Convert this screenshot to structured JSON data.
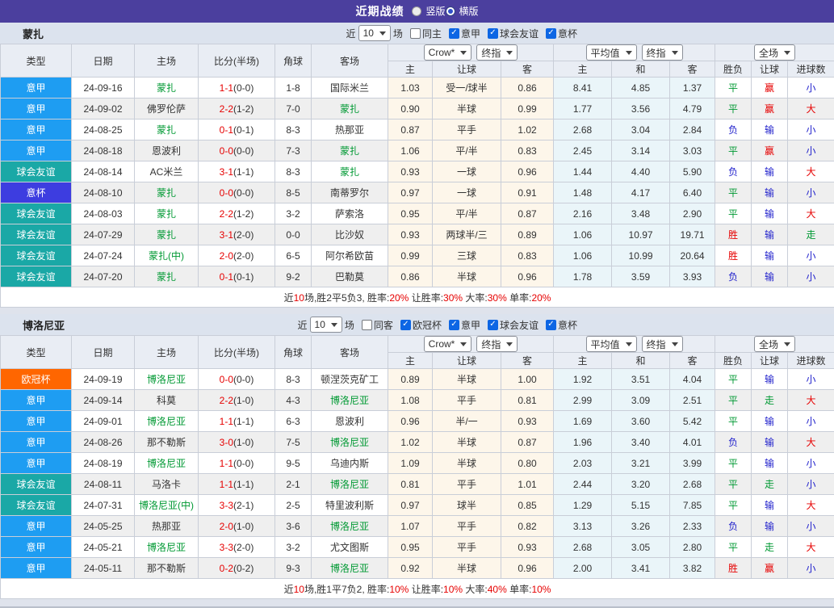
{
  "header": {
    "title": "近期战绩",
    "layout_options": [
      {
        "label": "竖版",
        "selected": false
      },
      {
        "label": "横版",
        "selected": true
      }
    ]
  },
  "filter_labels": {
    "near": "近",
    "suffix": "场"
  },
  "table_columns": {
    "main": [
      "类型",
      "日期",
      "主场",
      "比分(半场)",
      "角球",
      "客场"
    ],
    "odds_selects": [
      "Crow*",
      "终指"
    ],
    "avg_selects": [
      "平均值",
      "终指"
    ],
    "result_selects": [
      "全场"
    ],
    "odds_sub": [
      "主",
      "让球",
      "客"
    ],
    "avg_sub": [
      "主",
      "和",
      "客"
    ],
    "result_sub": [
      "胜负",
      "让球",
      "进球数"
    ]
  },
  "colors": {
    "type_colors": {
      "意甲": "#1e9df2",
      "球会友谊": "#1aa8a6",
      "意杯": "#3d3de0",
      "欧冠杯": "#ff6600"
    },
    "result_colors": {
      "胜": "red",
      "赢": "red",
      "大": "red",
      "平": "green",
      "走": "green",
      "负": "blue",
      "输": "blue",
      "小": "blue"
    },
    "red": "#e60000",
    "green": "#009933",
    "blue": "#2222cc",
    "accent_bar": "#4b3f9e",
    "checkbox_blue": "#0d66e4"
  },
  "tables": [
    {
      "team": "蒙扎",
      "filter": {
        "matches_value": "10",
        "checkboxes": [
          {
            "label": "同主",
            "checked": false
          },
          {
            "label": "意甲",
            "checked": true
          },
          {
            "label": "球会友谊",
            "checked": true
          },
          {
            "label": "意杯",
            "checked": true
          }
        ]
      },
      "rows": [
        {
          "type": "意甲",
          "date": "24-09-16",
          "home": "蒙扎",
          "home_self": true,
          "score": "1-1",
          "half": "(0-0)",
          "corner": "1-8",
          "away": "国际米兰",
          "away_self": false,
          "odds": [
            "1.03",
            "受一/球半",
            "0.86"
          ],
          "avg": [
            "8.41",
            "4.85",
            "1.37"
          ],
          "results": [
            "平",
            "赢",
            "小"
          ]
        },
        {
          "type": "意甲",
          "date": "24-09-02",
          "home": "佛罗伦萨",
          "home_self": false,
          "score": "2-2",
          "half": "(1-2)",
          "corner": "7-0",
          "away": "蒙扎",
          "away_self": true,
          "odds": [
            "0.90",
            "半球",
            "0.99"
          ],
          "avg": [
            "1.77",
            "3.56",
            "4.79"
          ],
          "results": [
            "平",
            "赢",
            "大"
          ]
        },
        {
          "type": "意甲",
          "date": "24-08-25",
          "home": "蒙扎",
          "home_self": true,
          "score": "0-1",
          "half": "(0-1)",
          "corner": "8-3",
          "away": "热那亚",
          "away_self": false,
          "odds": [
            "0.87",
            "平手",
            "1.02"
          ],
          "avg": [
            "2.68",
            "3.04",
            "2.84"
          ],
          "results": [
            "负",
            "输",
            "小"
          ]
        },
        {
          "type": "意甲",
          "date": "24-08-18",
          "home": "恩波利",
          "home_self": false,
          "score": "0-0",
          "half": "(0-0)",
          "corner": "7-3",
          "away": "蒙扎",
          "away_self": true,
          "odds": [
            "1.06",
            "平/半",
            "0.83"
          ],
          "avg": [
            "2.45",
            "3.14",
            "3.03"
          ],
          "results": [
            "平",
            "赢",
            "小"
          ]
        },
        {
          "type": "球会友谊",
          "date": "24-08-14",
          "home": "AC米兰",
          "home_self": false,
          "score": "3-1",
          "half": "(1-1)",
          "corner": "8-3",
          "away": "蒙扎",
          "away_self": true,
          "odds": [
            "0.93",
            "一球",
            "0.96"
          ],
          "avg": [
            "1.44",
            "4.40",
            "5.90"
          ],
          "results": [
            "负",
            "输",
            "大"
          ]
        },
        {
          "type": "意杯",
          "date": "24-08-10",
          "home": "蒙扎",
          "home_self": true,
          "score": "0-0",
          "half": "(0-0)",
          "corner": "8-5",
          "away": "南蒂罗尔",
          "away_self": false,
          "odds": [
            "0.97",
            "一球",
            "0.91"
          ],
          "avg": [
            "1.48",
            "4.17",
            "6.40"
          ],
          "results": [
            "平",
            "输",
            "小"
          ]
        },
        {
          "type": "球会友谊",
          "date": "24-08-03",
          "home": "蒙扎",
          "home_self": true,
          "score": "2-2",
          "half": "(1-2)",
          "corner": "3-2",
          "away": "萨索洛",
          "away_self": false,
          "odds": [
            "0.95",
            "平/半",
            "0.87"
          ],
          "avg": [
            "2.16",
            "3.48",
            "2.90"
          ],
          "results": [
            "平",
            "输",
            "大"
          ]
        },
        {
          "type": "球会友谊",
          "date": "24-07-29",
          "home": "蒙扎",
          "home_self": true,
          "score": "3-1",
          "half": "(2-0)",
          "corner": "0-0",
          "away": "比沙奴",
          "away_self": false,
          "odds": [
            "0.93",
            "两球半/三",
            "0.89"
          ],
          "avg": [
            "1.06",
            "10.97",
            "19.71"
          ],
          "results": [
            "胜",
            "输",
            "走"
          ]
        },
        {
          "type": "球会友谊",
          "date": "24-07-24",
          "home": "蒙扎(中)",
          "home_self": true,
          "score": "2-0",
          "half": "(2-0)",
          "corner": "6-5",
          "away": "阿尔希欧苗",
          "away_self": false,
          "odds": [
            "0.99",
            "三球",
            "0.83"
          ],
          "avg": [
            "1.06",
            "10.99",
            "20.64"
          ],
          "results": [
            "胜",
            "输",
            "小"
          ]
        },
        {
          "type": "球会友谊",
          "date": "24-07-20",
          "home": "蒙扎",
          "home_self": true,
          "score": "0-1",
          "half": "(0-1)",
          "corner": "9-2",
          "away": "巴勒莫",
          "away_self": false,
          "odds": [
            "0.86",
            "半球",
            "0.96"
          ],
          "avg": [
            "1.78",
            "3.59",
            "3.93"
          ],
          "results": [
            "负",
            "输",
            "小"
          ]
        }
      ],
      "footer": [
        {
          "text": "近",
          "red": false
        },
        {
          "text": "10",
          "red": true
        },
        {
          "text": "场,胜2平5负3, 胜率:",
          "red": false
        },
        {
          "text": "20%",
          "red": true
        },
        {
          "text": " 让胜率:",
          "red": false
        },
        {
          "text": "30%",
          "red": true
        },
        {
          "text": " 大率:",
          "red": false
        },
        {
          "text": "30%",
          "red": true
        },
        {
          "text": " 单率:",
          "red": false
        },
        {
          "text": "20%",
          "red": true
        }
      ]
    },
    {
      "team": "博洛尼亚",
      "filter": {
        "matches_value": "10",
        "checkboxes": [
          {
            "label": "同客",
            "checked": false
          },
          {
            "label": "欧冠杯",
            "checked": true
          },
          {
            "label": "意甲",
            "checked": true
          },
          {
            "label": "球会友谊",
            "checked": true
          },
          {
            "label": "意杯",
            "checked": true
          }
        ]
      },
      "rows": [
        {
          "type": "欧冠杯",
          "date": "24-09-19",
          "home": "博洛尼亚",
          "home_self": true,
          "score": "0-0",
          "half": "(0-0)",
          "corner": "8-3",
          "away": "顿涅茨克矿工",
          "away_self": false,
          "odds": [
            "0.89",
            "半球",
            "1.00"
          ],
          "avg": [
            "1.92",
            "3.51",
            "4.04"
          ],
          "results": [
            "平",
            "输",
            "小"
          ]
        },
        {
          "type": "意甲",
          "date": "24-09-14",
          "home": "科莫",
          "home_self": false,
          "score": "2-2",
          "half": "(1-0)",
          "corner": "4-3",
          "away": "博洛尼亚",
          "away_self": true,
          "odds": [
            "1.08",
            "平手",
            "0.81"
          ],
          "avg": [
            "2.99",
            "3.09",
            "2.51"
          ],
          "results": [
            "平",
            "走",
            "大"
          ]
        },
        {
          "type": "意甲",
          "date": "24-09-01",
          "home": "博洛尼亚",
          "home_self": true,
          "score": "1-1",
          "half": "(1-1)",
          "corner": "6-3",
          "away": "恩波利",
          "away_self": false,
          "odds": [
            "0.96",
            "半/一",
            "0.93"
          ],
          "avg": [
            "1.69",
            "3.60",
            "5.42"
          ],
          "results": [
            "平",
            "输",
            "小"
          ]
        },
        {
          "type": "意甲",
          "date": "24-08-26",
          "home": "那不勒斯",
          "home_self": false,
          "score": "3-0",
          "half": "(1-0)",
          "corner": "7-5",
          "away": "博洛尼亚",
          "away_self": true,
          "odds": [
            "1.02",
            "半球",
            "0.87"
          ],
          "avg": [
            "1.96",
            "3.40",
            "4.01"
          ],
          "results": [
            "负",
            "输",
            "大"
          ]
        },
        {
          "type": "意甲",
          "date": "24-08-19",
          "home": "博洛尼亚",
          "home_self": true,
          "score": "1-1",
          "half": "(0-0)",
          "corner": "9-5",
          "away": "乌迪内斯",
          "away_self": false,
          "odds": [
            "1.09",
            "半球",
            "0.80"
          ],
          "avg": [
            "2.03",
            "3.21",
            "3.99"
          ],
          "results": [
            "平",
            "输",
            "小"
          ]
        },
        {
          "type": "球会友谊",
          "date": "24-08-11",
          "home": "马洛卡",
          "home_self": false,
          "score": "1-1",
          "half": "(1-1)",
          "corner": "2-1",
          "away": "博洛尼亚",
          "away_self": true,
          "odds": [
            "0.81",
            "平手",
            "1.01"
          ],
          "avg": [
            "2.44",
            "3.20",
            "2.68"
          ],
          "results": [
            "平",
            "走",
            "小"
          ]
        },
        {
          "type": "球会友谊",
          "date": "24-07-31",
          "home": "博洛尼亚(中)",
          "home_self": true,
          "score": "3-3",
          "half": "(2-1)",
          "corner": "2-5",
          "away": "特里波利斯",
          "away_self": false,
          "odds": [
            "0.97",
            "球半",
            "0.85"
          ],
          "avg": [
            "1.29",
            "5.15",
            "7.85"
          ],
          "results": [
            "平",
            "输",
            "大"
          ]
        },
        {
          "type": "意甲",
          "date": "24-05-25",
          "home": "热那亚",
          "home_self": false,
          "score": "2-0",
          "half": "(1-0)",
          "corner": "3-6",
          "away": "博洛尼亚",
          "away_self": true,
          "odds": [
            "1.07",
            "平手",
            "0.82"
          ],
          "avg": [
            "3.13",
            "3.26",
            "2.33"
          ],
          "results": [
            "负",
            "输",
            "小"
          ]
        },
        {
          "type": "意甲",
          "date": "24-05-21",
          "home": "博洛尼亚",
          "home_self": true,
          "score": "3-3",
          "half": "(2-0)",
          "corner": "3-2",
          "away": "尤文图斯",
          "away_self": false,
          "odds": [
            "0.95",
            "平手",
            "0.93"
          ],
          "avg": [
            "2.68",
            "3.05",
            "2.80"
          ],
          "results": [
            "平",
            "走",
            "大"
          ]
        },
        {
          "type": "意甲",
          "date": "24-05-11",
          "home": "那不勒斯",
          "home_self": false,
          "score": "0-2",
          "half": "(0-2)",
          "corner": "9-3",
          "away": "博洛尼亚",
          "away_self": true,
          "odds": [
            "0.92",
            "半球",
            "0.96"
          ],
          "avg": [
            "2.00",
            "3.41",
            "3.82"
          ],
          "results": [
            "胜",
            "赢",
            "小"
          ]
        }
      ],
      "footer": [
        {
          "text": "近",
          "red": false
        },
        {
          "text": "10",
          "red": true
        },
        {
          "text": "场,胜1平7负2, 胜率:",
          "red": false
        },
        {
          "text": "10%",
          "red": true
        },
        {
          "text": " 让胜率:",
          "red": false
        },
        {
          "text": "10%",
          "red": true
        },
        {
          "text": " 大率:",
          "red": false
        },
        {
          "text": "40%",
          "red": true
        },
        {
          "text": " 单率:",
          "red": false
        },
        {
          "text": "10%",
          "red": true
        }
      ]
    }
  ]
}
